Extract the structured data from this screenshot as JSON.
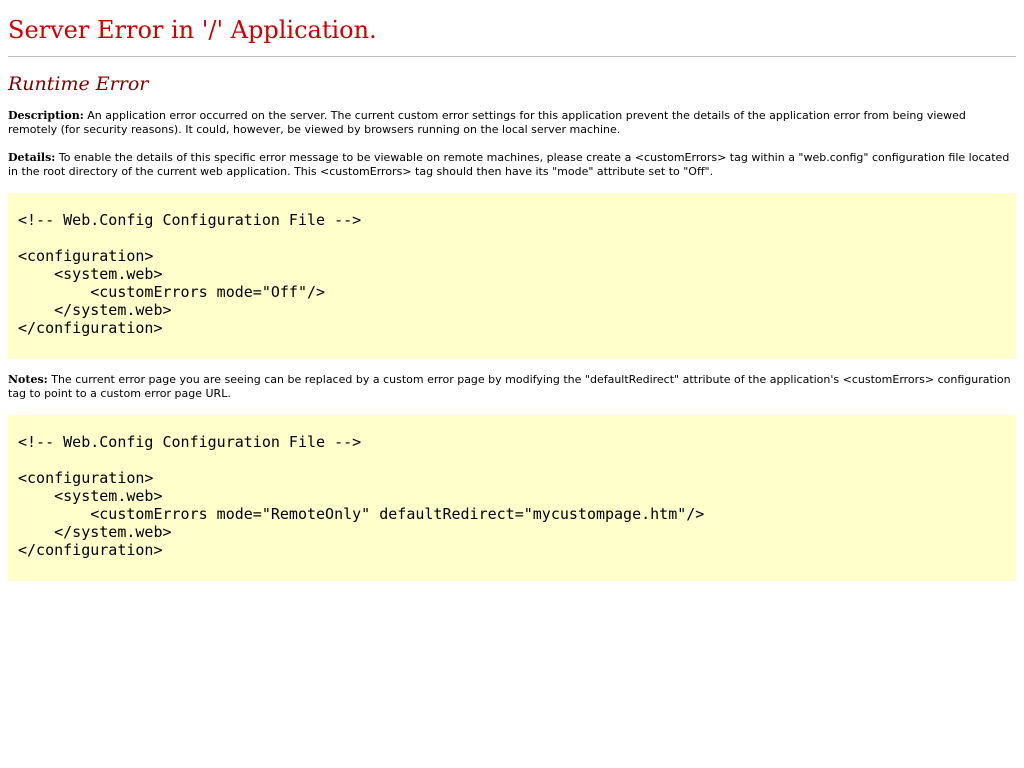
{
  "title": "Server Error in '/' Application.",
  "error_type": "Runtime Error",
  "description": {
    "label": "Description:",
    "text": "An application error occurred on the server. The current custom error settings for this application prevent the details of the application error from being viewed remotely (for security reasons). It could, however, be viewed by browsers running on the local server machine."
  },
  "details": {
    "label": "Details:",
    "text": "To enable the details of this specific error message to be viewable on remote machines, please create a <customErrors> tag within a \"web.config\" configuration file located in the root directory of the current web application. This <customErrors> tag should then have its \"mode\" attribute set to \"Off\"."
  },
  "code_sample_1": "<!-- Web.Config Configuration File -->\n\n<configuration>\n    <system.web>\n        <customErrors mode=\"Off\"/>\n    </system.web>\n</configuration>",
  "notes": {
    "label": "Notes:",
    "text": "The current error page you are seeing can be replaced by a custom error page by modifying the \"defaultRedirect\" attribute of the application's <customErrors> configuration tag to point to a custom error page URL."
  },
  "code_sample_2": "<!-- Web.Config Configuration File -->\n\n<configuration>\n    <system.web>\n        <customErrors mode=\"RemoteOnly\" defaultRedirect=\"mycustompage.htm\"/>\n    </system.web>\n</configuration>"
}
